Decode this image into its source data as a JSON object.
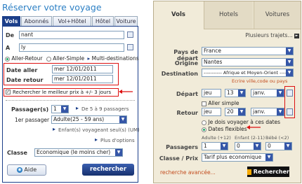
{
  "left": {
    "title": "Réserver votre voyage",
    "tabs": [
      "Vols",
      "Abonnés",
      "Vol+Hôtel",
      "Hôtel",
      "Voiture"
    ],
    "from_label": "De",
    "from_value": "nant",
    "to_label": "A",
    "to_value": "ly",
    "trip_round": "Aller-Retour",
    "trip_oneway": "Aller-Simple",
    "trip_multi": "Multi-destinations",
    "depart_label": "Date aller",
    "depart_value": "mer 12/01/2011",
    "return_label": "Date retour",
    "return_value": "mer 12/01/2011",
    "flex_label": "Rechercher le meilleur prix à +/- 3 jours",
    "pax_label": "Passager(s)",
    "pax_value": "1",
    "pax_group_link": "De 5 à 9 passagers",
    "first_pax_label": "1er passager",
    "first_pax_value": "Adulte(25 - 59 ans)",
    "unaccompanied_link": "Enfant(s) voyageant seul(s) (UM)",
    "more_options": "Plus d'options",
    "class_label": "Classe",
    "class_value": "Economique (le moins cher)",
    "help_button": "Aide",
    "search_button": "rechercher"
  },
  "right": {
    "tabs": [
      "Vols",
      "Hotels",
      "Voitures"
    ],
    "multi_link": "Plusieurs trajets...",
    "country_label": "Pays de départ",
    "country_value": "France",
    "origin_label": "Origine",
    "origin_value": "Nantes",
    "dest_label": "Destination",
    "dest_value": "----------- Afrique et Moyen-Orient -----",
    "dest_hint": "Ecrire ville,code ou pays",
    "depart_label": "Départ",
    "depart_day": "jeu",
    "depart_date": "13",
    "depart_month": "janv.",
    "oneway_label": "Aller simple",
    "return_label": "Retour",
    "return_day": "jeu",
    "return_date": "20",
    "return_month": "janv.",
    "fixed_dates": "Je dois voyager à ces dates",
    "flex_dates": "Dates flexibles",
    "adult_hdr": "Adulte (+12)",
    "child_hdr": "Enfant (2-11)",
    "baby_hdr": "Bébé (<2)",
    "pax_label": "Passagers",
    "adult_value": "1",
    "child_value": "0",
    "baby_value": "0",
    "class_label": "Classe / Prix",
    "class_value": "Tarif plus economique",
    "advanced_link": "recherche avancée...",
    "search_button": "Rechercher"
  }
}
